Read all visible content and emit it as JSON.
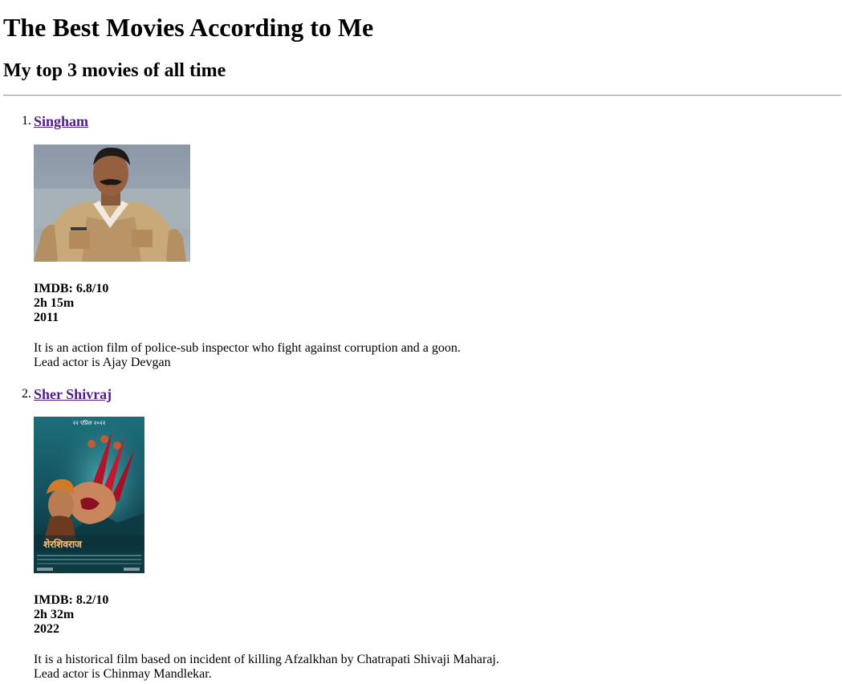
{
  "page": {
    "title": "The Best Movies According to Me",
    "subtitle": "My top 3 movies of all time"
  },
  "movies": [
    {
      "number": "1.",
      "title": "Singham",
      "image_alt": "Singham still",
      "imdb": "IMDB: 6.8/10",
      "duration": "2h 15m",
      "year": "2011",
      "description_line1": "It is an action film of police-sub inspector who fight against corruption and a goon.",
      "description_line2": "Lead actor is Ajay Devgan"
    },
    {
      "number": "2.",
      "title": "Sher Shivraj",
      "image_alt": "Sher Shivraj poster",
      "poster_date": "२२ एप्रिल २०२२",
      "poster_title": "शेरशिवराज",
      "imdb": "IMDB: 8.2/10",
      "duration": "2h 32m",
      "year": "2022",
      "description_line1": "It is a historical film based on incident of killing Afzalkhan by Chatrapati Shivaji Maharaj.",
      "description_line2": "Lead actor is Chinmay Mandlekar."
    }
  ],
  "colors": {
    "link_visited": "#551a8b",
    "divider": "#9a9a9a"
  }
}
